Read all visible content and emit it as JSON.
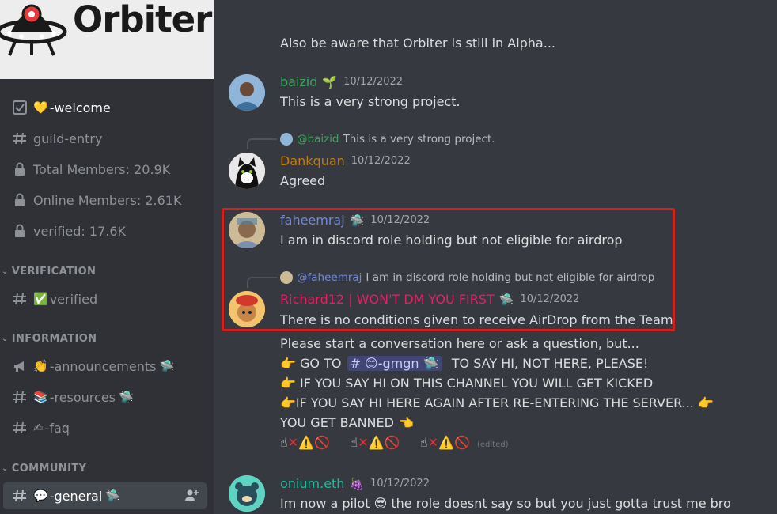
{
  "server": {
    "name": "Orbiter"
  },
  "sidebar": {
    "channels_top": [
      {
        "label": "-welcome",
        "emoji": "💛"
      },
      {
        "label": "guild-entry"
      },
      {
        "label": "Total Members: 20.9K"
      },
      {
        "label": "Online Members: 2.61K"
      },
      {
        "label": "verified: 17.6K"
      }
    ],
    "categories": {
      "verification": "VERIFICATION",
      "information": "INFORMATION",
      "community": "COMMUNITY"
    },
    "verification_channels": [
      {
        "label": "verified",
        "emoji": "✅"
      }
    ],
    "information_channels": [
      {
        "label": "-announcements",
        "emoji": "👏",
        "suffix": "🛸"
      },
      {
        "label": "-resources",
        "emoji": "📚",
        "suffix": "🛸"
      },
      {
        "label": "-faq",
        "emoji": "✍"
      }
    ],
    "community_channels": [
      {
        "label": "-general",
        "emoji": "💬",
        "suffix": "🛸"
      }
    ]
  },
  "chat": {
    "top_text": "Also be aware that Orbiter is still in Alpha...",
    "messages": [
      {
        "user": "baizid",
        "user_color": "#3ba55c",
        "badge": "🌱",
        "timestamp": "10/12/2022",
        "text": "This is a very strong project."
      },
      {
        "reply_to_user": "@baizid",
        "reply_text": "This is a very strong project.",
        "user": "Dankquan",
        "user_color": "#c27c0e",
        "timestamp": "10/12/2022",
        "text": "Agreed"
      },
      {
        "user": "faheemraj",
        "user_color": "#7289da",
        "badge": "🛸",
        "timestamp": "10/12/2022",
        "text": "I am in discord role holding but not eligible for airdrop"
      },
      {
        "reply_to_user": "@faheemraj",
        "reply_text": "I am in discord role holding but not eligible for airdrop",
        "user": "Richard12 | WON'T DM YOU FIRST",
        "user_color": "#e91e63",
        "badge": "🛸",
        "timestamp": "10/12/2022",
        "text": "There is no conditions given to receive AirDrop from the Team"
      }
    ],
    "system_lines": {
      "l1": "Please start a conversation here or ask a question, but...",
      "l2_a": "GO TO",
      "l2_chip": "-gmgn",
      "l2_b": "TO SAY HI, NOT HERE, PLEASE!",
      "l3": "IF YOU SAY HI ON THIS CHANNEL YOU WILL GET KICKED",
      "l4": "IF YOU SAY HI HERE AGAIN AFTER RE-ENTERING THE SERVER...",
      "l5": "YOU GET BANNED",
      "edited": "(edited)"
    },
    "last_message": {
      "user": "onium.eth",
      "user_color": "#1abc9c",
      "badge": "🍇",
      "timestamp": "10/12/2022",
      "text_a": "Im now a pilot",
      "text_b": "the role doesnt say so but you just gotta trust me bro"
    }
  },
  "colors": {
    "background": "#36393f",
    "sidebar": "#2f3136",
    "highlight": "#d02020",
    "mention": "#414675"
  }
}
